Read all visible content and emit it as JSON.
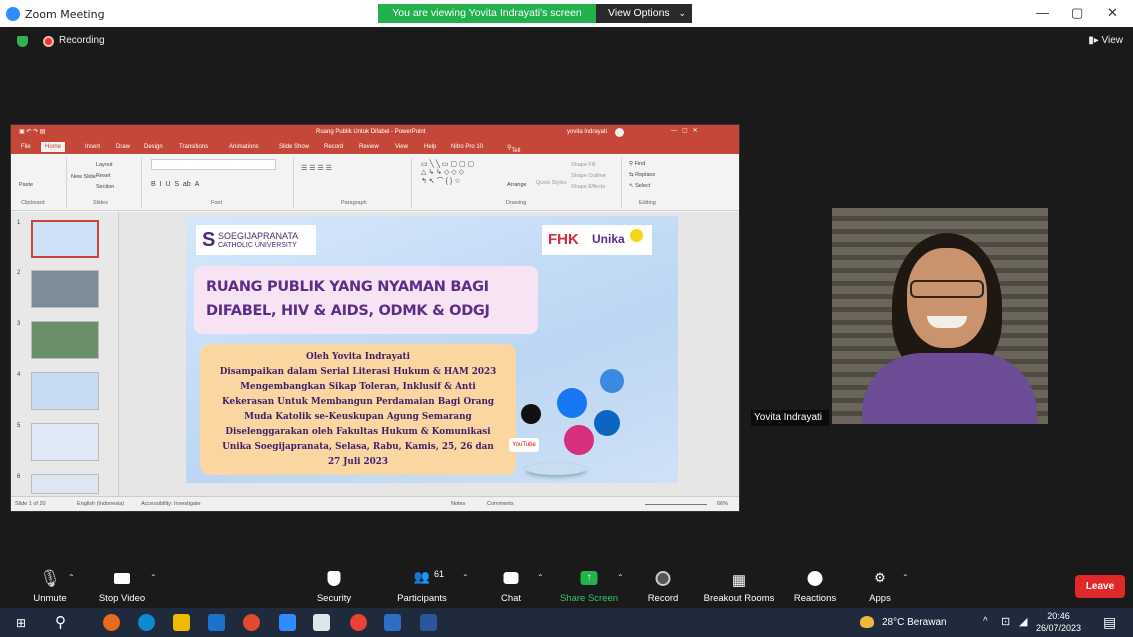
{
  "window": {
    "title": "Zoom Meeting",
    "minimize": "—",
    "maximize": "▢",
    "close": "✕"
  },
  "banner": {
    "viewing": "You are viewing Yovita Indrayati's screen",
    "view_options": "View Options"
  },
  "meeting": {
    "recording": "Recording",
    "view": "View"
  },
  "powerpoint": {
    "doc_title": "Ruang Publik Untuk Difabel - PowerPoint",
    "user": "yovita indrayati",
    "tabs": [
      "File",
      "Home",
      "Insert",
      "Draw",
      "Design",
      "Transitions",
      "Animations",
      "Slide Show",
      "Record",
      "Review",
      "View",
      "Help",
      "Nitro Pro 10"
    ],
    "tell_me": "Tell me what you want to do",
    "ribbon_groups": [
      "Clipboard",
      "Slides",
      "Font",
      "Paragraph",
      "Drawing",
      "Editing"
    ],
    "ribbon_items": {
      "paste": "Paste",
      "new_slide": "New Slide",
      "layout": "Layout",
      "reset": "Reset",
      "section": "Section",
      "arrange": "Arrange",
      "quick_styles": "Quick Styles",
      "find": "Find",
      "replace": "Replace",
      "select": "Select",
      "shape_fill": "Shape Fill",
      "shape_outline": "Shape Outline",
      "shape_effects": "Shape Effects"
    },
    "slide_numbers": [
      "1",
      "2",
      "3",
      "4",
      "5",
      "6"
    ],
    "status": {
      "slide": "Slide 1 of 20",
      "language": "English (Indonesia)",
      "accessibility": "Accessibility: Investigate",
      "notes": "Notes",
      "comments": "Comments",
      "zoom": "66%"
    }
  },
  "slide": {
    "logo_left_line1": "SOEGIJAPRANATA",
    "logo_left_line2": "CATHOLIC UNIVERSITY",
    "logo_right_fhk": "FHK",
    "logo_right_unika": "Unika",
    "title_line1": "RUANG PUBLIK YANG NYAMAN BAGI",
    "title_line2": "DIFABEL, HIV & AIDS, ODMK & ODGJ",
    "info_lines": [
      "Oleh Yovita Indrayati",
      "Disampaikan dalam Serial Literasi Hukum & HAM 2023",
      "Mengembangkan Sikap Toleran, Inklusif & Anti",
      "Kekerasan Untuk Membangun Perdamaian Bagi Orang",
      "Muda Katolik se-Keuskupan Agung Semarang",
      "Diselenggarakan oleh Fakultas Hukum & Komunikasi",
      "Unika Soegijapranata,  Selasa, Rabu, Kamis, 25, 26 dan",
      "27 Juli 2023"
    ],
    "youtube_label": "YouTube"
  },
  "presenter": {
    "name": "Yovita Indrayati"
  },
  "toolbar": {
    "unmute": "Unmute",
    "stop_video": "Stop Video",
    "security": "Security",
    "participants": "Participants",
    "participants_count": "61",
    "chat": "Chat",
    "share_screen": "Share Screen",
    "record": "Record",
    "breakout_rooms": "Breakout Rooms",
    "reactions": "Reactions",
    "apps": "Apps",
    "leave": "Leave"
  },
  "taskbar": {
    "weather": "28°C  Berawan",
    "time": "20:46",
    "date": "26/07/2023",
    "tray": "^"
  },
  "colors": {
    "zoom_blue": "#2d8cff",
    "green_banner": "#22b14c",
    "leave_red": "#e02828",
    "ppt_red": "#c4473a",
    "slide_purple": "#5c2d8a"
  }
}
